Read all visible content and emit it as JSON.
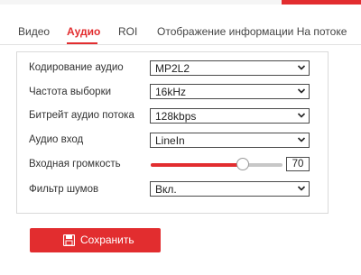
{
  "tabs": [
    {
      "label": "Видео",
      "active": false
    },
    {
      "label": "Аудио",
      "active": true
    },
    {
      "label": "ROI",
      "active": false
    },
    {
      "label": "Отображение информации На потоке",
      "active": false
    }
  ],
  "form": {
    "encoding": {
      "label": "Кодирование аудио",
      "value": "MP2L2"
    },
    "sample_rate": {
      "label": "Частота выборки",
      "value": "16kHz"
    },
    "bitrate": {
      "label": "Битрейт аудио потока",
      "value": "128kbps"
    },
    "audio_input": {
      "label": "Аудио вход",
      "value": "LineIn"
    },
    "input_volume": {
      "label": "Входная громкость",
      "value": "70",
      "min": 0,
      "max": 100
    },
    "noise_filter": {
      "label": "Фильтр шумов",
      "value": "Вкл."
    }
  },
  "save_button": {
    "label": "Сохранить",
    "icon": "save-icon"
  },
  "colors": {
    "accent": "#e22d2f",
    "track": "#c7c7c7"
  }
}
